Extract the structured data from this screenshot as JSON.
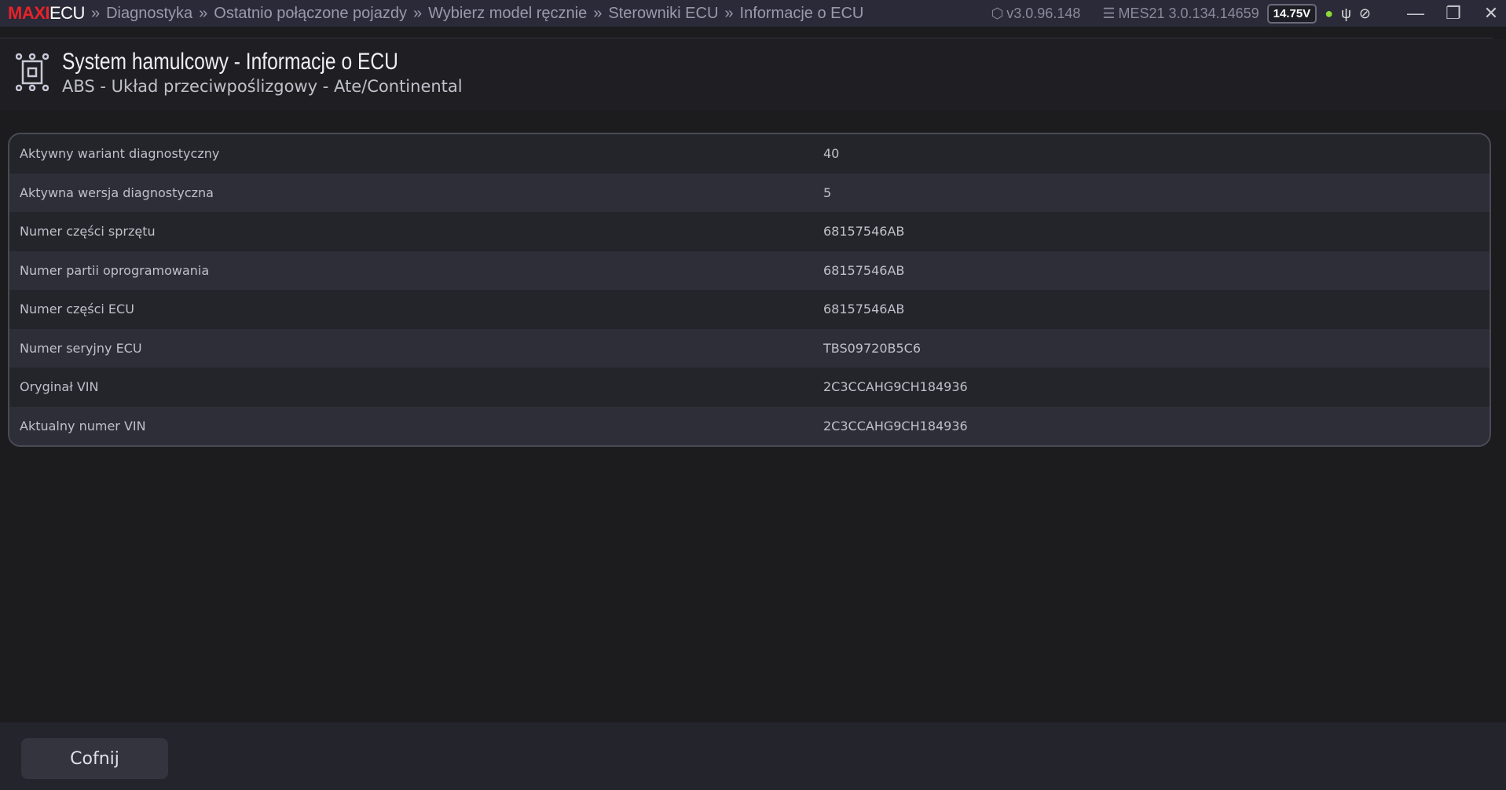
{
  "header": {
    "logo_maxi": "MAXI",
    "logo_ecu": "ECU",
    "separator": "»",
    "breadcrumbs": [
      "Diagnostyka",
      "Ostatnio połączone pojazdy",
      "Wybierz model ręcznie",
      "Sterowniki ECU",
      "Informacje o ECU"
    ],
    "version": "v3.0.96.148",
    "device": "MES21 3.0.134.14659",
    "voltage": "14.75V"
  },
  "page": {
    "title": "System hamulcowy - Informacje o ECU",
    "subtitle": "ABS - Układ przeciwpoślizgowy - Ate/Continental"
  },
  "rows": [
    {
      "label": "Aktywny wariant diagnostyczny",
      "value": "40"
    },
    {
      "label": "Aktywna wersja diagnostyczna",
      "value": "5"
    },
    {
      "label": "Numer części sprzętu",
      "value": "68157546AB"
    },
    {
      "label": "Numer partii oprogramowania",
      "value": "68157546AB"
    },
    {
      "label": "Numer części ECU",
      "value": "68157546AB"
    },
    {
      "label": "Numer seryjny ECU",
      "value": "TBS09720B5C6"
    },
    {
      "label": "Oryginał VIN",
      "value": "2C3CCAHG9CH184936"
    },
    {
      "label": "Aktualny numer VIN",
      "value": "2C3CCAHG9CH184936"
    }
  ],
  "footer": {
    "back_label": "Cofnij"
  }
}
